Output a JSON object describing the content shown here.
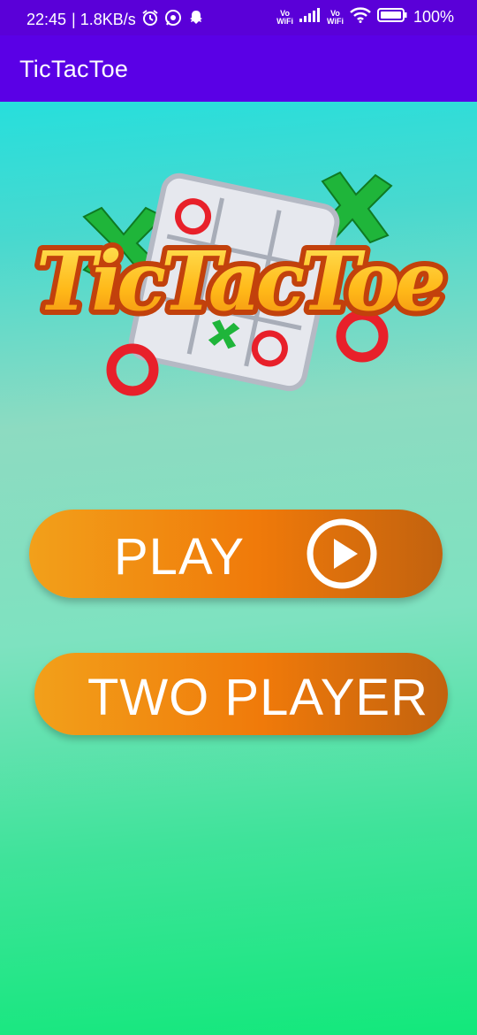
{
  "status_bar": {
    "time": "22:45",
    "speed": "| 1.8KB/s",
    "volte1": "Vo\nWiFi",
    "volte2": "Vo\nWiFi",
    "battery": "100%"
  },
  "app_bar": {
    "title": "TicTacToe"
  },
  "logo": {
    "text": "TicTacToe"
  },
  "buttons": {
    "play": "PLAY",
    "two_player": "TWO PLAYER"
  },
  "colors": {
    "status_bar": "#5a00d8",
    "app_bar": "#5a00e6",
    "button_start": "#f2a01a",
    "button_end": "#c2620e"
  }
}
